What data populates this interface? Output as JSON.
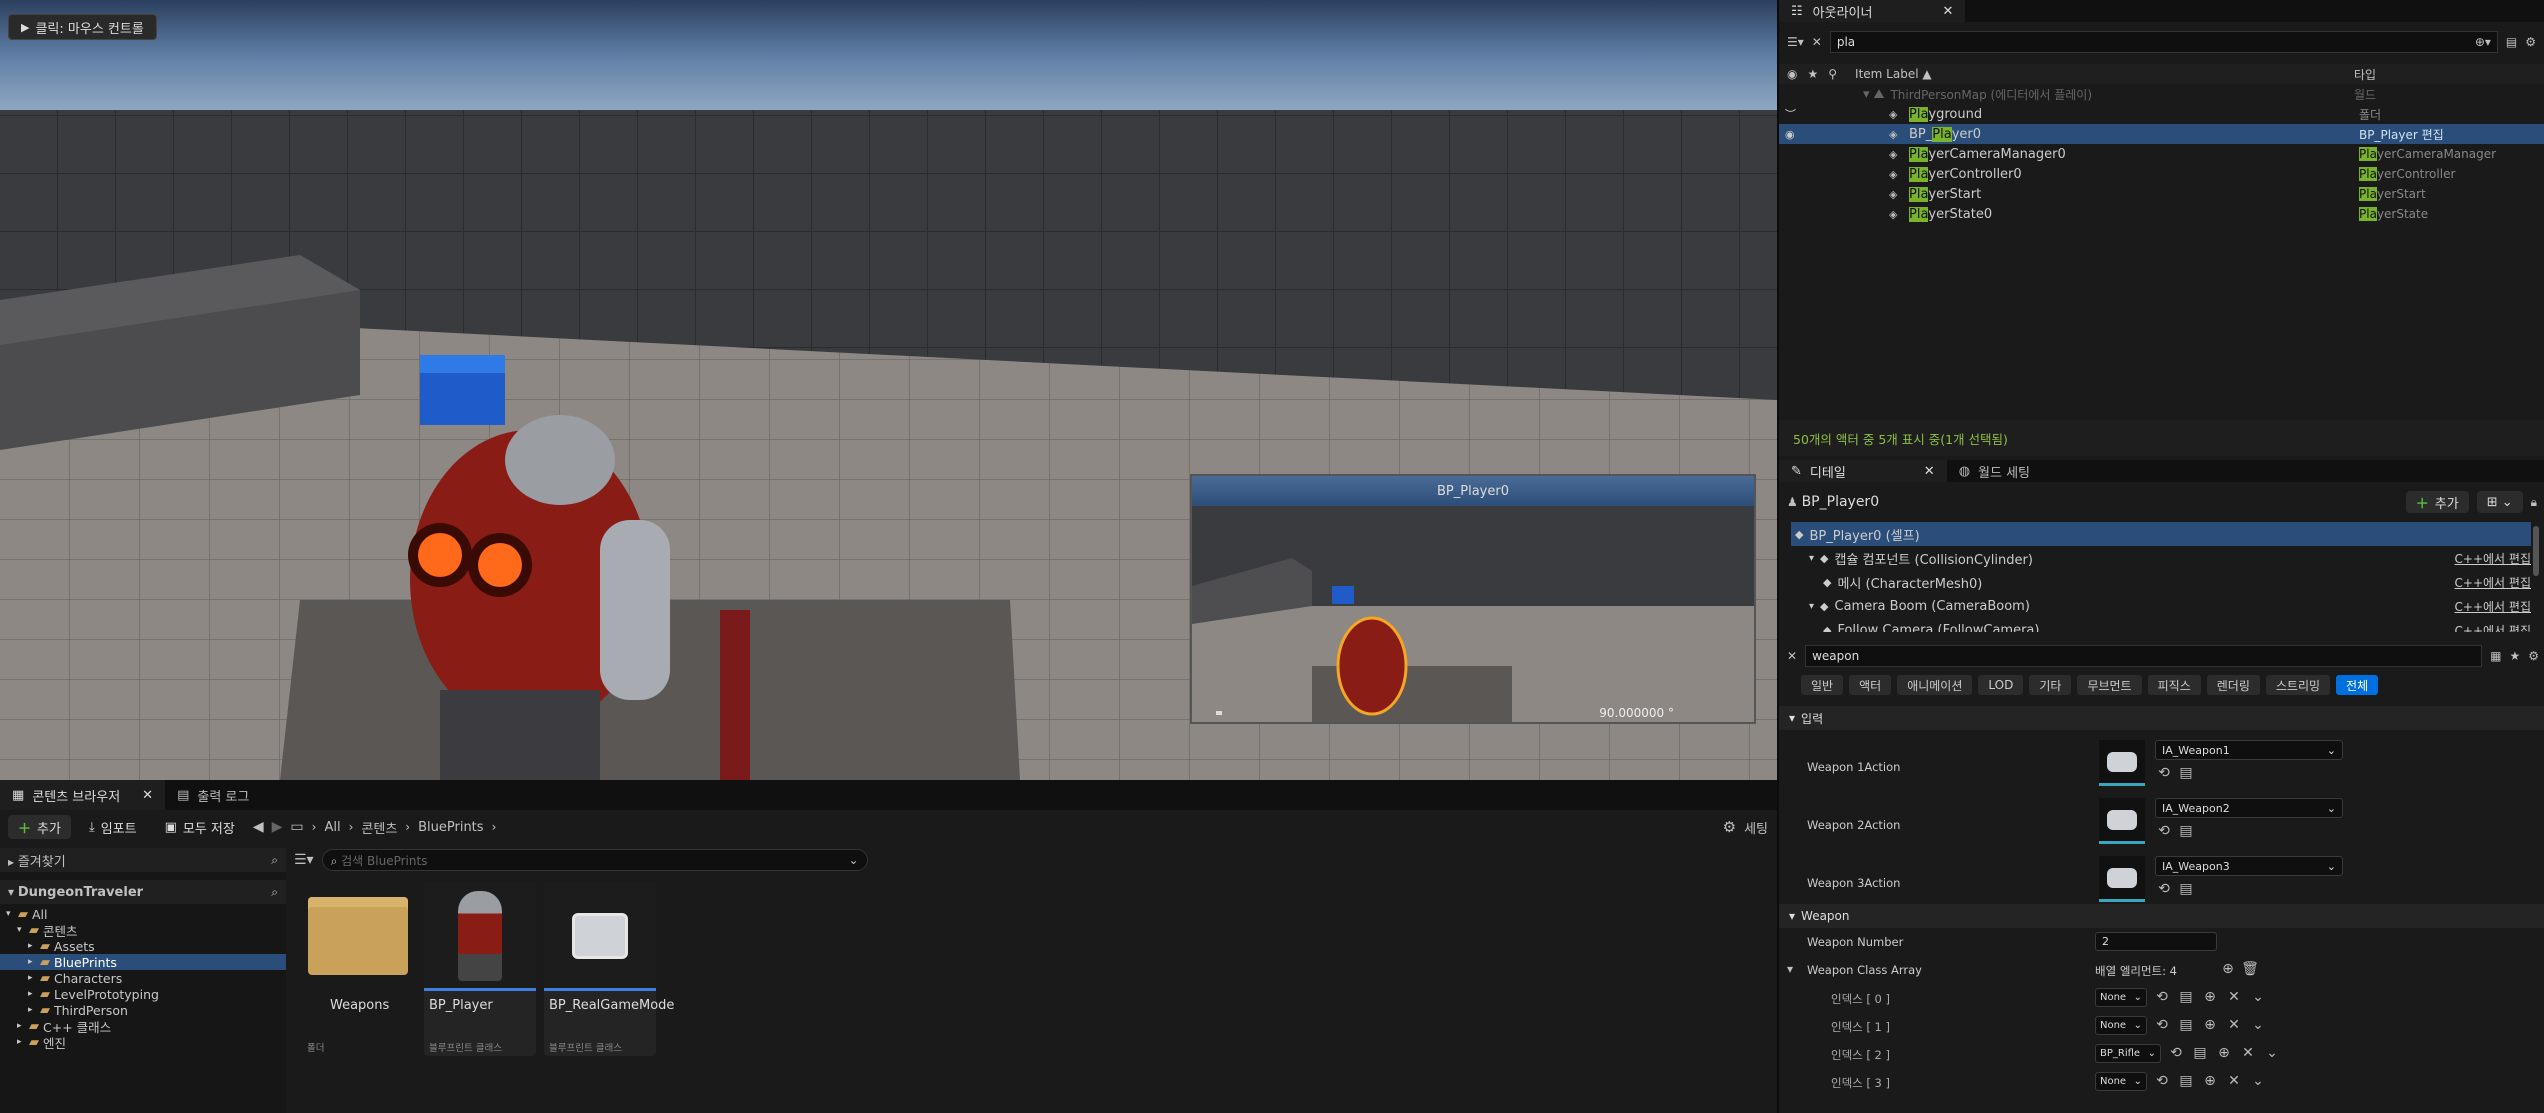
{
  "viewport": {
    "hint": "클릭: 마우스 컨트롤",
    "preview_title": "BP_Player0",
    "preview_value": "90.000000 °"
  },
  "content_browser": {
    "tabs": [
      "콘텐츠 브라우저",
      "출력 로그"
    ],
    "toolbar": {
      "add": "추가",
      "import": "임포트",
      "save_all": "모두 저장",
      "settings": "세팅"
    },
    "breadcrumb": [
      "All",
      "콘텐츠",
      "BluePrints"
    ],
    "search_placeholder": "검색 BluePrints",
    "favorites_label": "즐겨찾기",
    "project_label": "DungeonTraveler",
    "tree": [
      {
        "label": "All",
        "depth": 0,
        "selected": false
      },
      {
        "label": "콘텐츠",
        "depth": 1,
        "selected": false
      },
      {
        "label": "Assets",
        "depth": 2,
        "selected": false
      },
      {
        "label": "BluePrints",
        "depth": 2,
        "selected": true
      },
      {
        "label": "Characters",
        "depth": 2,
        "selected": false
      },
      {
        "label": "LevelPrototyping",
        "depth": 2,
        "selected": false
      },
      {
        "label": "ThirdPerson",
        "depth": 2,
        "selected": false
      },
      {
        "label": "C++ 클래스",
        "depth": 1,
        "selected": false
      },
      {
        "label": "엔진",
        "depth": 1,
        "selected": false
      }
    ],
    "assets": [
      {
        "name": "Weapons",
        "type": "폴더"
      },
      {
        "name": "BP_Player",
        "type": "블루프린트 클래스"
      },
      {
        "name": "BP_RealGameMode",
        "type": "블루프린트 클래스"
      }
    ]
  },
  "outliner": {
    "tab": "아웃라이너",
    "search_value": "pla",
    "col_label": "Item Label ▲",
    "col_type": "타입",
    "world_row": {
      "label": "ThirdPersonMap (에디터에서 플레이)",
      "type": "월드"
    },
    "rows": [
      {
        "pre": "",
        "hl": "Pla",
        "post": "yground",
        "type_hl": "",
        "type_post": "폴더",
        "icon": "folder-icon",
        "selected": false
      },
      {
        "pre": "BP_",
        "hl": "Pla",
        "post": "yer0",
        "type_hl": "",
        "type_post": "BP_Player 편집",
        "icon": "pawn-icon",
        "selected": true
      },
      {
        "pre": "",
        "hl": "Pla",
        "post": "yerCameraManager0",
        "type_hl": "Pla",
        "type_post": "yerCameraManager",
        "icon": "camera-manager-icon",
        "selected": false
      },
      {
        "pre": "",
        "hl": "Pla",
        "post": "yerController0",
        "type_hl": "Pla",
        "type_post": "yerController",
        "icon": "controller-icon",
        "selected": false
      },
      {
        "pre": "",
        "hl": "Pla",
        "post": "yerStart",
        "type_hl": "Pla",
        "type_post": "yerStart",
        "icon": "player-start-icon",
        "selected": false
      },
      {
        "pre": "",
        "hl": "Pla",
        "post": "yerState0",
        "type_hl": "Pla",
        "type_post": "yerState",
        "icon": "state-icon",
        "selected": false
      }
    ],
    "status": "50개의 액터 중 5개 표시 중(1개 선택됨)"
  },
  "details": {
    "tabs": [
      "디테일",
      "월드 세팅"
    ],
    "actor_name": "BP_Player0",
    "add_label": "추가",
    "components": [
      {
        "label": "BP_Player0 (셀프)",
        "edit": "",
        "depth": 0,
        "selected": true
      },
      {
        "label": "캡슐 컴포넌트 (CollisionCylinder)",
        "edit": "C++에서 편집",
        "depth": 1,
        "selected": false
      },
      {
        "label": "메시 (CharacterMesh0)",
        "edit": "C++에서 편집",
        "depth": 2,
        "selected": false
      },
      {
        "label": "Camera Boom (CameraBoom)",
        "edit": "C++에서 편집",
        "depth": 1,
        "selected": false
      },
      {
        "label": "Follow Camera (FollowCamera)",
        "edit": "C++에서 편집",
        "depth": 2,
        "selected": false
      }
    ],
    "search_value": "weapon",
    "categories": [
      "일반",
      "액터",
      "애니메이션",
      "LOD",
      "기타",
      "무브먼트",
      "피직스",
      "렌더링",
      "스트리밍",
      "전체"
    ],
    "active_category": "전체",
    "input_section": "입력",
    "actions": [
      {
        "label": "Weapon 1Action",
        "value": "IA_Weapon1"
      },
      {
        "label": "Weapon 2Action",
        "value": "IA_Weapon2"
      },
      {
        "label": "Weapon 3Action",
        "value": "IA_Weapon3"
      }
    ],
    "weapon_section": "Weapon",
    "weapon_number_label": "Weapon Number",
    "weapon_number": "2",
    "class_array_label": "Weapon Class Array",
    "class_array_count": "배열 엘리먼트: 4",
    "array_items": [
      {
        "label": "인덱스 [ 0 ]",
        "value": "None"
      },
      {
        "label": "인덱스 [ 1 ]",
        "value": "None"
      },
      {
        "label": "인덱스 [ 2 ]",
        "value": "BP_Rifle"
      },
      {
        "label": "인덱스 [ 3 ]",
        "value": "None"
      }
    ]
  }
}
